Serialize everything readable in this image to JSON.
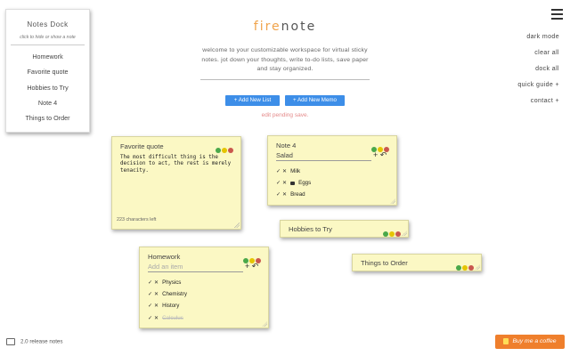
{
  "dock": {
    "title": "Notes Dock",
    "hint": "click to hide or show a note",
    "items": [
      "Homework",
      "Favorite quote",
      "Hobbies to Try",
      "Note 4",
      "Things to Order"
    ]
  },
  "header": {
    "logo_part1": "fire",
    "logo_part2": "note",
    "tagline": "welcome to your customizable workspace for virtual sticky notes. jot down your thoughts, write to-do lists, save paper and stay organized.",
    "add_list_label": "+ Add New List",
    "add_memo_label": "+ Add New Memo",
    "pending": "edit pending save."
  },
  "menu": {
    "dark_mode": "dark mode",
    "clear_all": "clear all",
    "dock_all": "dock all",
    "quick_guide": "quick guide +",
    "contact": "contact +"
  },
  "notes": {
    "favorite_quote": {
      "title": "Favorite quote",
      "text": "The most difficult thing is the decision to act, the rest is merely tenacity.",
      "chars_left": "223 characters left"
    },
    "note4": {
      "title": "Note 4",
      "input_value": "Salad",
      "items": [
        {
          "text": "Milk",
          "locked": false,
          "done": false
        },
        {
          "text": "Eggs",
          "locked": true,
          "done": false
        },
        {
          "text": "Bread",
          "locked": false,
          "done": false
        }
      ]
    },
    "hobbies": {
      "title": "Hobbies to Try"
    },
    "things": {
      "title": "Things to Order"
    },
    "homework": {
      "title": "Homework",
      "placeholder": "Add an item",
      "items": [
        {
          "text": "Physics",
          "done": false
        },
        {
          "text": "Chemistry",
          "done": false
        },
        {
          "text": "History",
          "done": false
        },
        {
          "text": "Calculus",
          "done": true
        }
      ]
    }
  },
  "icons": {
    "check": "✓",
    "delete": "✕",
    "add": "+",
    "undo": "↶"
  },
  "colors": {
    "note_bg": "#fbf8c4",
    "button_blue": "#3d8ee8",
    "accent_orange": "#f0a34a",
    "pending_red": "#e58a8a",
    "coffee_orange": "#ef7f2c"
  },
  "footer": {
    "release_notes": "2.0 release notes",
    "coffee": "Buy me a coffee"
  }
}
